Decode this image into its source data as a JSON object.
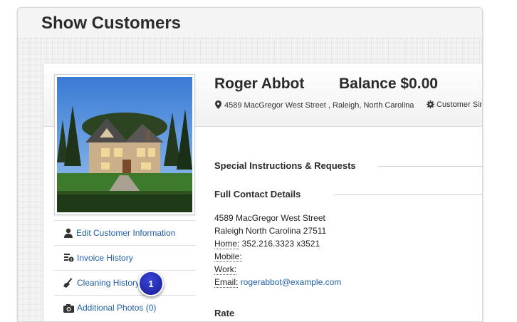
{
  "page": {
    "title": "Show Customers"
  },
  "customer": {
    "name": "Roger Abbot",
    "balance": "Balance $0.00",
    "address_line": "4589 MacGregor West Street , Raleigh, North Carolina",
    "since_label": "Customer Since"
  },
  "sections": {
    "special_instructions": "Special Instructions & Requests",
    "full_contact": "Full Contact Details",
    "rate": "Rate"
  },
  "contact": {
    "street": "4589 MacGregor West Street",
    "city_line": "Raleigh North Carolina 27511",
    "home_label": "Home:",
    "home_value": " 352.216.3323 x3521",
    "mobile_label": "Mobile:",
    "work_label": "Work:",
    "email_label": "Email:",
    "email_value": "rogerabbot@example.com"
  },
  "sidebar": {
    "items": [
      {
        "label": "Edit Customer Information",
        "icon": "user-icon"
      },
      {
        "label": "Invoice History",
        "icon": "invoice-icon"
      },
      {
        "label": "Cleaning History",
        "icon": "broom-icon"
      },
      {
        "label": "Additional Photos (0)",
        "icon": "camera-icon"
      }
    ]
  },
  "callout": {
    "number": "1"
  },
  "colors": {
    "link": "#1f5fa8",
    "callout": "#2a33c4"
  }
}
